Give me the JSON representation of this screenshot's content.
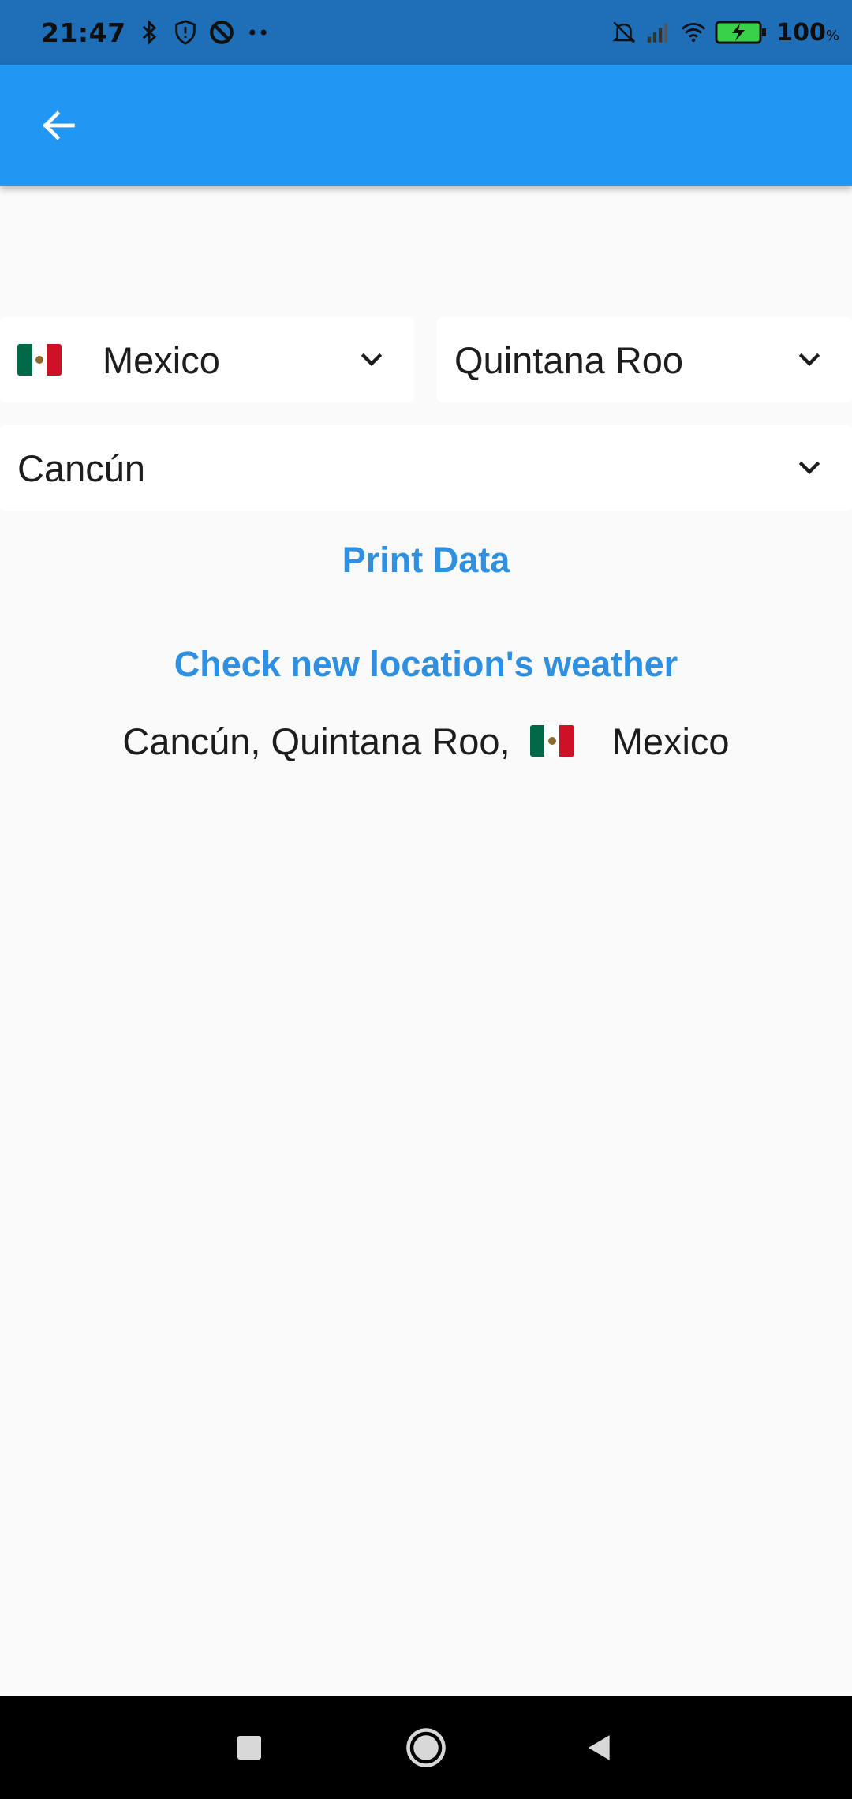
{
  "status_bar": {
    "time": "21:47",
    "battery_percent": "100",
    "battery_unit": "%",
    "icons": [
      "bluetooth-icon",
      "shield-icon",
      "blocked-icon",
      "dots-icon",
      "mute-icon",
      "signal-icon",
      "wifi-icon",
      "battery-charging-icon"
    ]
  },
  "app_bar": {
    "back_icon": "arrow-left-icon",
    "color": "#2196f3"
  },
  "selectors": {
    "country": {
      "flag": "mexico-flag",
      "value": "Mexico"
    },
    "state": {
      "value": "Quintana Roo"
    },
    "city": {
      "value": "Cancún"
    }
  },
  "actions": {
    "print_data": "Print Data",
    "check_weather": "Check new location's weather"
  },
  "result": {
    "prefix": "Cancún, Quintana Roo, ",
    "country": "Mexico"
  },
  "nav_bar": {
    "icons": [
      "recent-apps-icon",
      "home-icon",
      "back-triangle-icon"
    ]
  },
  "colors": {
    "accent": "#2196f3",
    "link": "#2f8fe1",
    "status_bar": "#1e6fb8",
    "background": "#fafafa"
  }
}
